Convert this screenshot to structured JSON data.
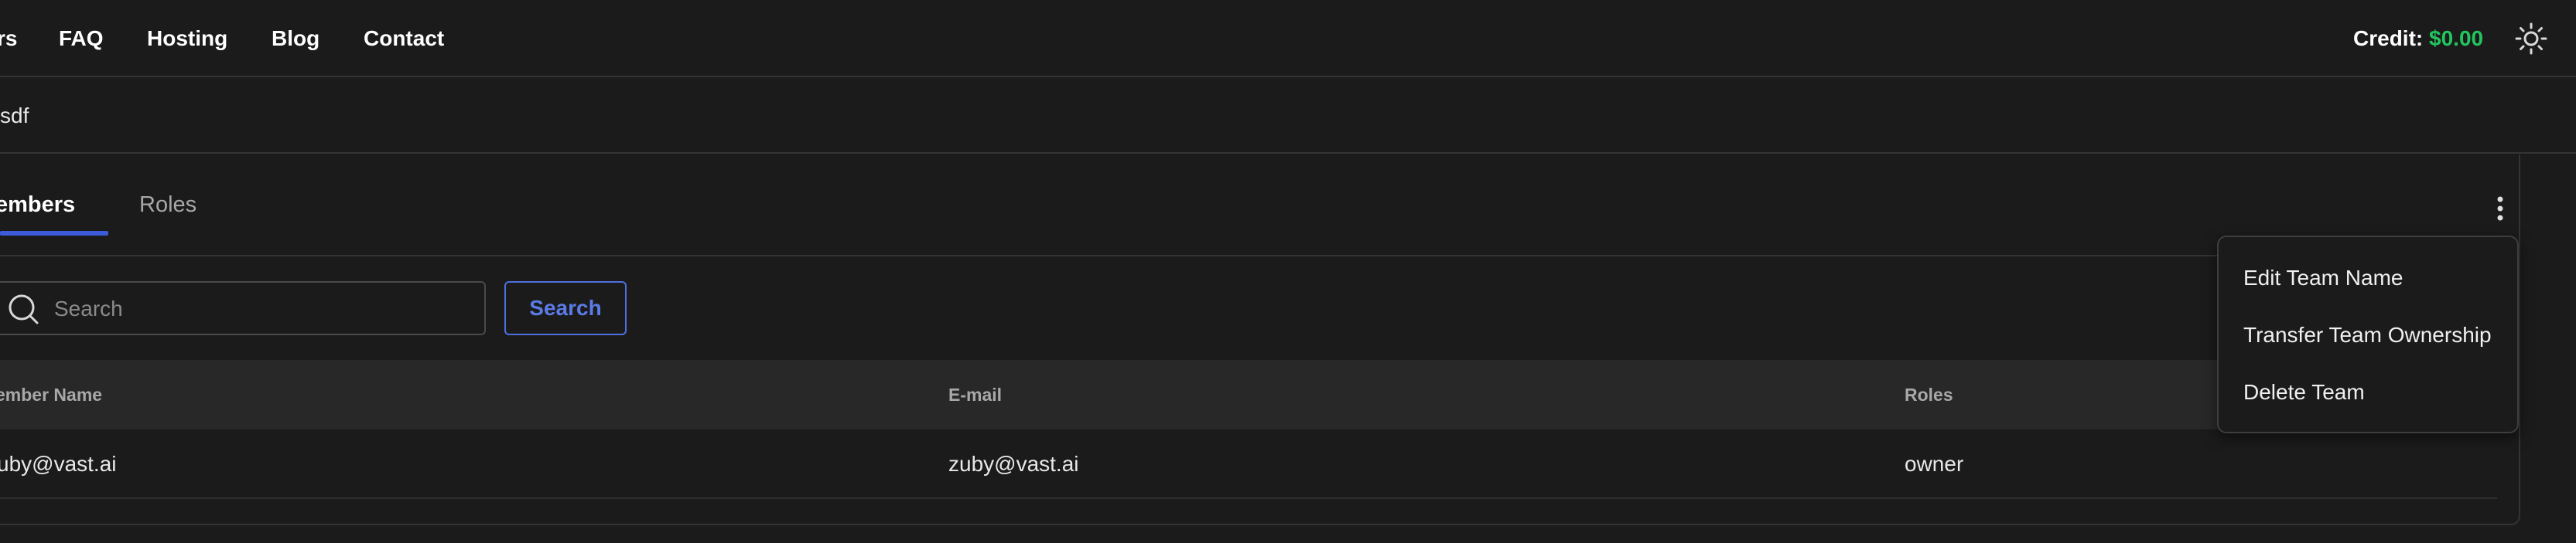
{
  "nav": {
    "items": [
      {
        "label": "rs"
      },
      {
        "label": "FAQ"
      },
      {
        "label": "Hosting"
      },
      {
        "label": "Blog"
      },
      {
        "label": "Contact"
      }
    ],
    "credit_label": "Credit:",
    "credit_amount": "$0.00",
    "credit_color": "#22c55e",
    "theme_icon": "sun-icon"
  },
  "team": {
    "name": "sdf"
  },
  "tabs": [
    {
      "label": "embers",
      "active": true
    },
    {
      "label": "Roles",
      "active": false
    }
  ],
  "accent_color": "#3b5bdb",
  "search": {
    "placeholder": "Search",
    "value": "",
    "button_label": "Search"
  },
  "table": {
    "columns": [
      "ember Name",
      "E-mail",
      "Roles"
    ],
    "rows": [
      [
        "uby@vast.ai",
        "zuby@vast.ai",
        "owner"
      ]
    ]
  },
  "menu": {
    "icon": "more-vertical-icon",
    "items": [
      {
        "label": "Edit Team Name"
      },
      {
        "label": "Transfer Team Ownership"
      },
      {
        "label": "Delete Team"
      }
    ]
  }
}
